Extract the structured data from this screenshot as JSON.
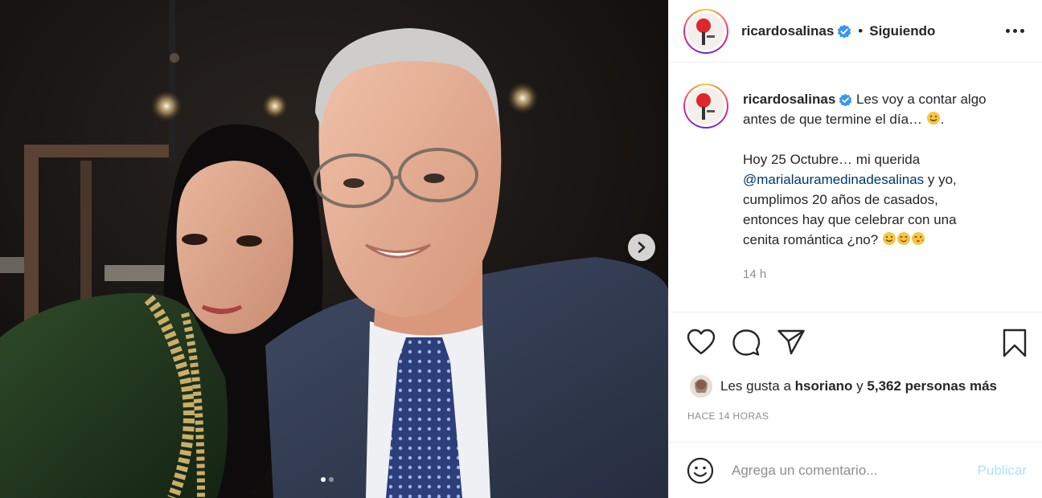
{
  "post": {
    "username": "ricardosalinas",
    "separator": "•",
    "follow_status": "Siguiendo",
    "caption": {
      "line1": "Les voy a contar algo",
      "line2": "antes de que termine el día…",
      "line2_end": ".",
      "line3": "Hoy 25 Octubre… mi querida",
      "mention": "@marialauramedinadesalinas",
      "line4_rest": " y yo,",
      "line5": "cumplimos 20 años de casados,",
      "line6": "entonces hay que celebrar con una",
      "line7": "cenita romántica ¿no?"
    },
    "time": "14 h",
    "likes": {
      "prefix": "Les gusta a",
      "user": "hsoriano",
      "connector": "y",
      "count_text": "5,362 personas más"
    },
    "date_ago": "HACE 14 HORAS",
    "comment": {
      "placeholder": "Agrega un comentario...",
      "publish_label": "Publicar"
    },
    "carousel": {
      "slides": 2,
      "active_index": 0
    }
  },
  "icons": {
    "verified": "verified-badge-icon",
    "more": "more-options-icon",
    "like": "heart-icon",
    "comment": "comment-icon",
    "share": "share-icon",
    "save": "bookmark-icon",
    "emoji": "emoji-icon",
    "next": "chevron-right-icon"
  },
  "colors": {
    "verified": "#3897f0",
    "mention": "#00376b",
    "publish_disabled": "#b2dffc",
    "muted": "#8e8e8e"
  }
}
